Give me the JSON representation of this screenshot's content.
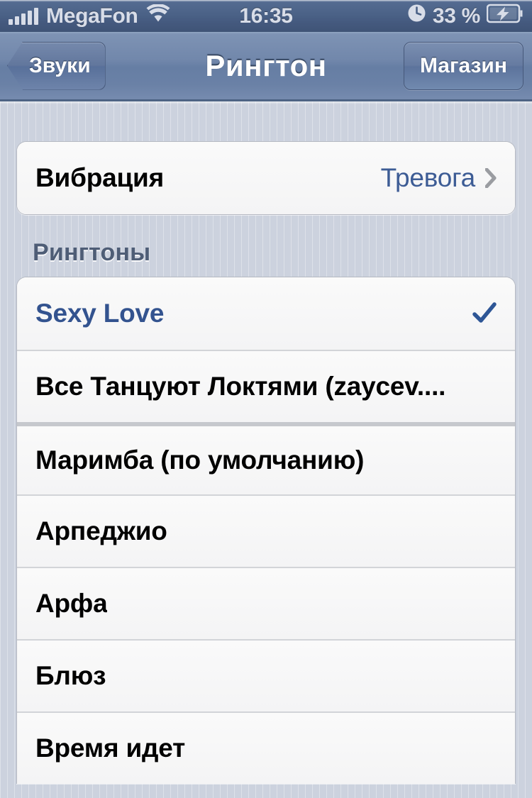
{
  "status_bar": {
    "signal_icon": "signal-bars-icon",
    "signal_bars_total": 5,
    "signal_bars_filled": 5,
    "carrier": "MegaFon",
    "wifi_icon": "wifi-icon",
    "time": "16:35",
    "alarm_icon": "clock-icon",
    "battery_percent": "33 %",
    "battery_icon": "battery-charging-icon"
  },
  "nav_bar": {
    "back_label": "Звуки",
    "back_icon": "chevron-left-icon",
    "title": "Рингтон",
    "store_label": "Магазин"
  },
  "vibration": {
    "label": "Вибрация",
    "value": "Тревога",
    "disclosure_icon": "chevron-right-icon"
  },
  "ringtones": {
    "header": "Рингтоны",
    "selected_icon": "checkmark-icon",
    "items": [
      {
        "label": "Sexy Love",
        "selected": true
      },
      {
        "label": "Все Танцуют Локтями (zaycev....",
        "selected": false
      },
      {
        "label": "Маримба (по умолчанию)",
        "selected": false
      },
      {
        "label": "Арпеджио",
        "selected": false
      },
      {
        "label": "Арфа",
        "selected": false
      },
      {
        "label": "Блюз",
        "selected": false
      },
      {
        "label": "Время идет",
        "selected": false
      }
    ]
  },
  "colors": {
    "nav_bar": "#6a81a6",
    "status_bar": "#47five",
    "background": "#ccd2de",
    "row_background": "#f7f7f7",
    "accent_blue": "#33538f",
    "value_blue": "#3d5c95",
    "header_text": "#4e5d76"
  }
}
